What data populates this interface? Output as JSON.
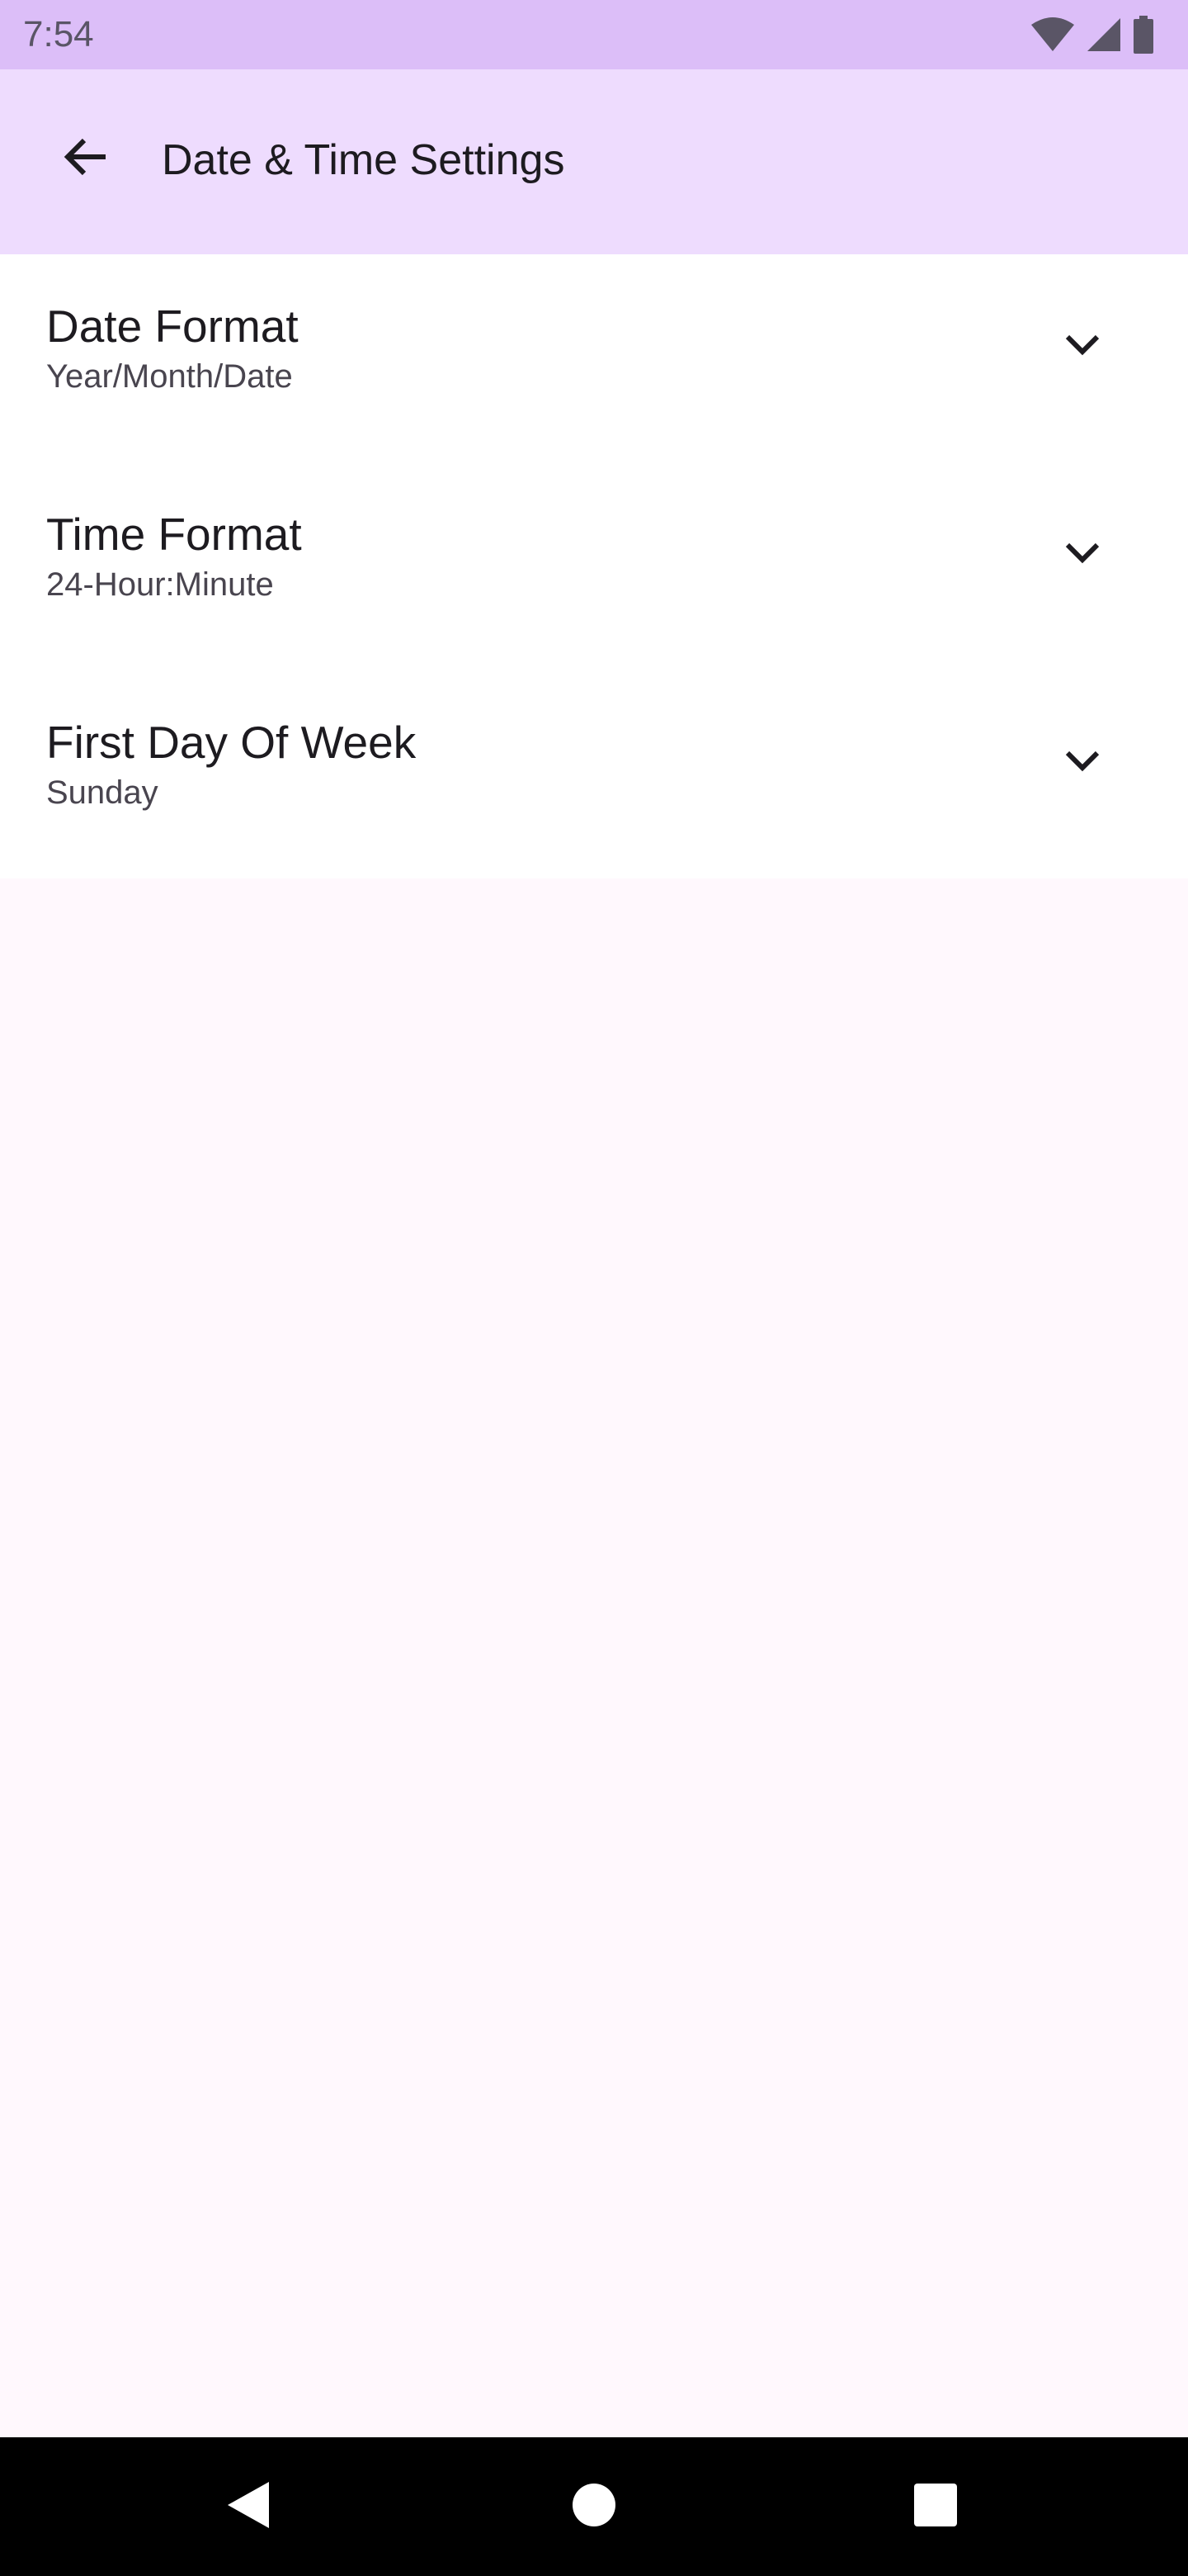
{
  "status_bar": {
    "time": "7:54",
    "icons": [
      "wifi-icon",
      "signal-icon",
      "battery-icon"
    ],
    "background": "#DCBEF8"
  },
  "app_bar": {
    "title": "Date & Time Settings",
    "back_icon": "arrow-back-icon",
    "background": "#EEDCFE"
  },
  "settings": [
    {
      "title": "Date Format",
      "value": "Year/Month/Date",
      "icon": "chevron-down-icon"
    },
    {
      "title": "Time Format",
      "value": "24-Hour:Minute",
      "icon": "chevron-down-icon"
    },
    {
      "title": "First Day Of Week",
      "value": "Sunday",
      "icon": "chevron-down-icon"
    }
  ],
  "nav_bar": {
    "buttons": [
      "back-triangle-icon",
      "home-circle-icon",
      "recents-square-icon"
    ]
  }
}
